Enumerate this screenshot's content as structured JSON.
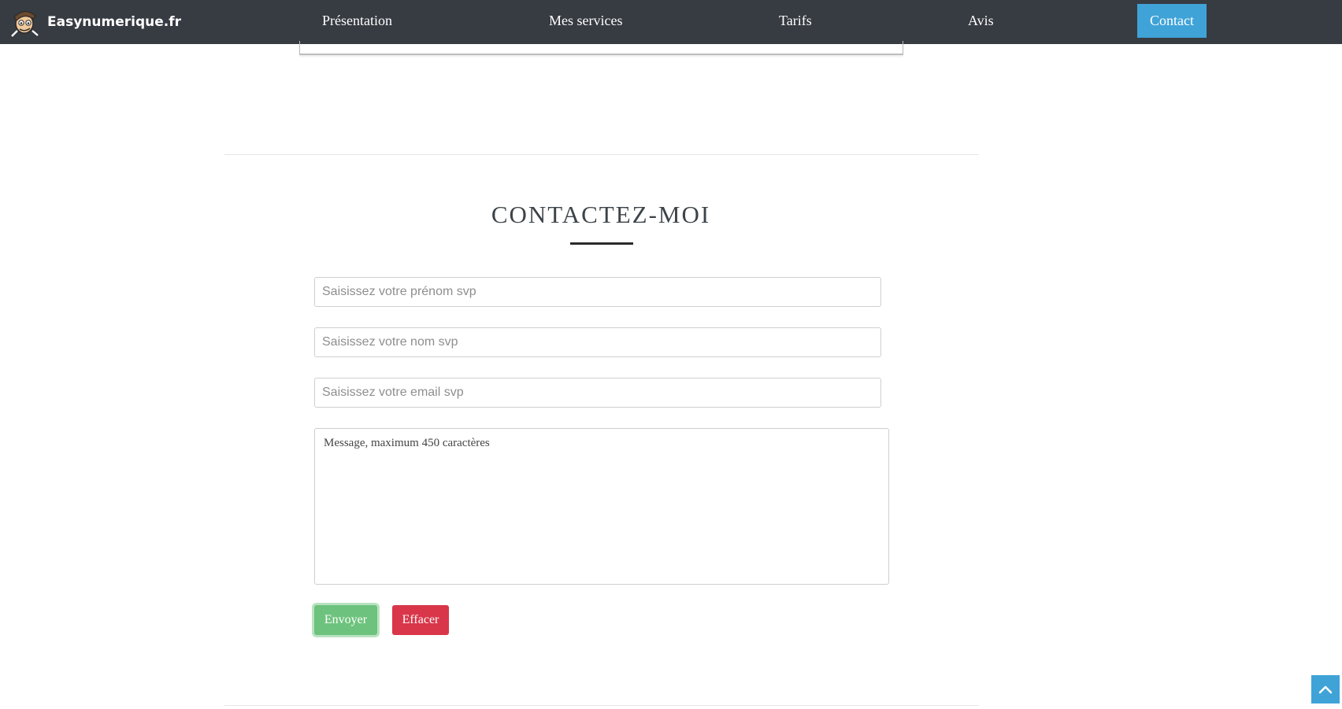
{
  "nav": {
    "brand": "Easynumerique.fr",
    "links": [
      "Présentation",
      "Mes services",
      "Tarifs",
      "Avis"
    ],
    "contact": "Contact"
  },
  "contact_section": {
    "title": "CONTACTEZ-MOI",
    "firstname_placeholder": "Saisissez votre prénom svp",
    "lastname_placeholder": "Saisissez votre nom svp",
    "email_placeholder": "Saisissez votre email svp",
    "message_placeholder": "Message, maximum 450 caractères",
    "send_label": "Envoyer",
    "clear_label": "Effacer"
  },
  "icons": {
    "logo": "cartoon-mascot-logo",
    "scroll_top": "chevron-up-icon"
  },
  "colors": {
    "navbar": "#373b42",
    "accent": "#3fa3d8",
    "send": "#6dc37d",
    "clear": "#d9364a"
  }
}
